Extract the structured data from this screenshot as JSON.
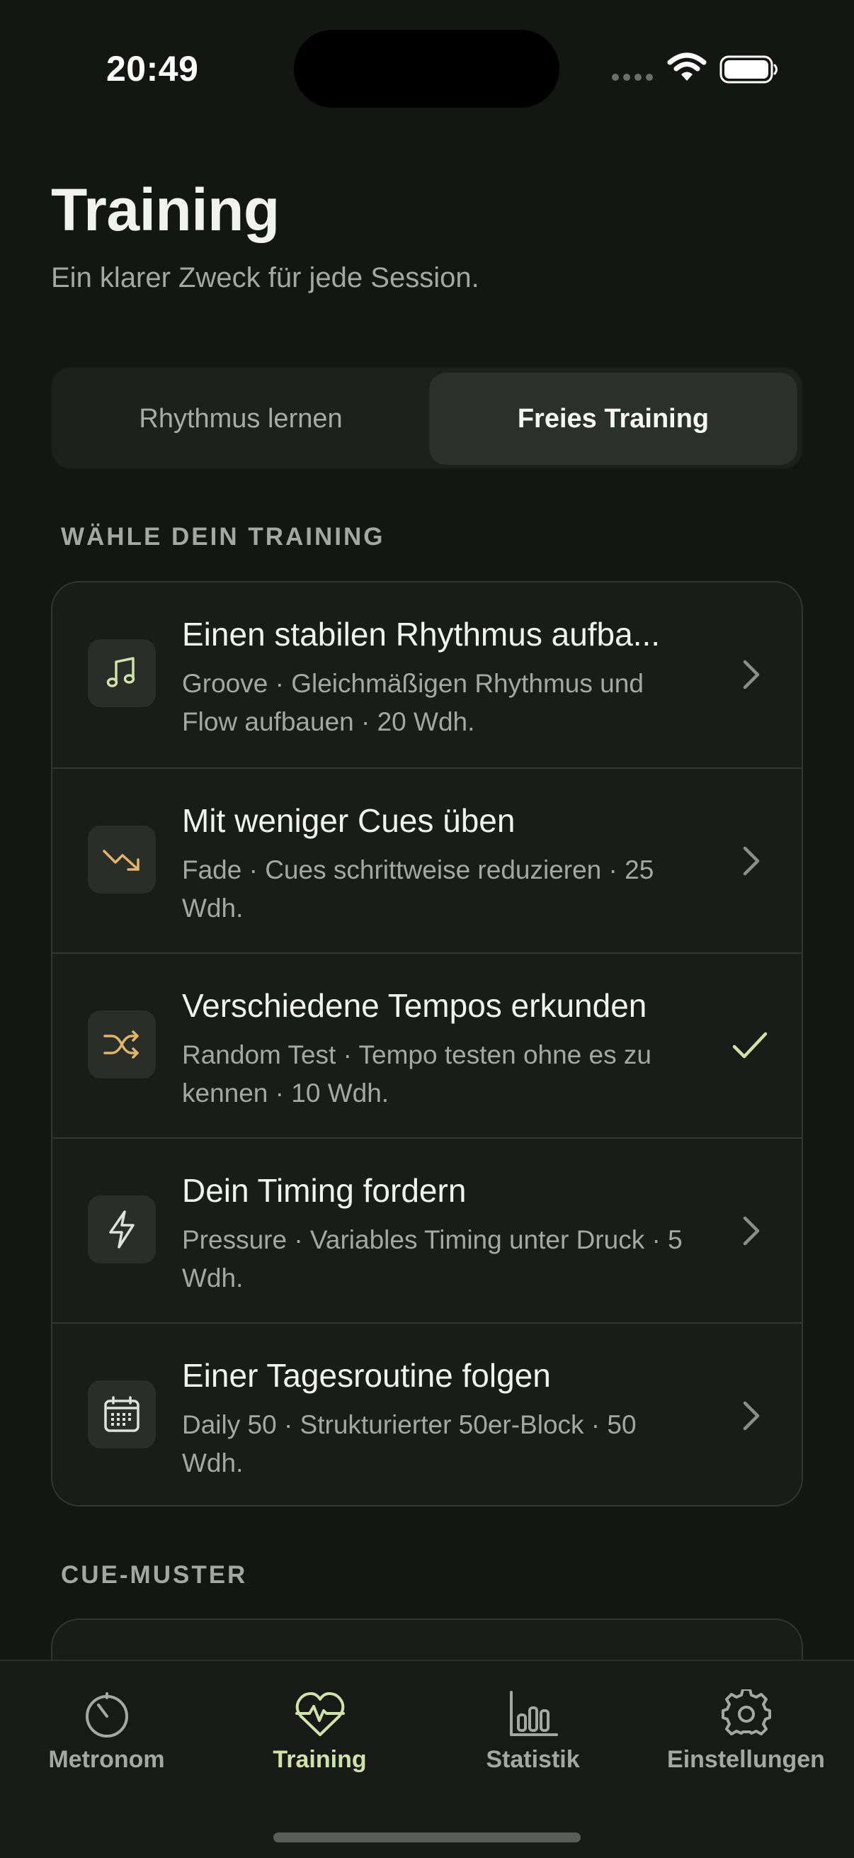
{
  "status_bar": {
    "time": "20:49"
  },
  "header": {
    "title": "Training",
    "subtitle": "Ein klarer Zweck für jede Session."
  },
  "segmented": {
    "left": "Rhythmus lernen",
    "right": "Freies Training",
    "selected": "Freies Training"
  },
  "sections": {
    "choose": "WÄHLE DEIN TRAINING",
    "cue": "CUE-MUSTER"
  },
  "trainings": [
    {
      "title": "Einen stabilen Rhythmus aufba...",
      "desc": "Groove · Gleichmäßigen Rhythmus und Flow aufbauen · 20 Wdh.",
      "icon": "music-note-icon",
      "trailing": "chevron"
    },
    {
      "title": "Mit weniger Cues üben",
      "desc": "Fade · Cues schrittweise reduzieren · 25 Wdh.",
      "icon": "trend-down-icon",
      "trailing": "chevron"
    },
    {
      "title": "Verschiedene Tempos erkunden",
      "desc": "Random Test · Tempo testen ohne es zu kennen · 10 Wdh.",
      "icon": "shuffle-icon",
      "trailing": "check"
    },
    {
      "title": "Dein Timing fordern",
      "desc": "Pressure · Variables Timing unter Druck · 5 Wdh.",
      "icon": "lightning-icon",
      "trailing": "chevron"
    },
    {
      "title": "Einer Tagesroutine folgen",
      "desc": "Daily 50 · Strukturierter 50er-Block · 50 Wdh.",
      "icon": "calendar-icon",
      "trailing": "chevron"
    }
  ],
  "tabs": [
    {
      "label": "Metronom",
      "icon": "metronome-gauge-icon"
    },
    {
      "label": "Training",
      "icon": "heart-pulse-icon",
      "active": true
    },
    {
      "label": "Statistik",
      "icon": "bar-chart-icon"
    },
    {
      "label": "Einstellungen",
      "icon": "gear-icon"
    }
  ],
  "colors": {
    "background": "#141614",
    "accent_green": "#cfe3a8",
    "icon_amber": "#e2b46a",
    "text_secondary": "#a4a8a2"
  }
}
